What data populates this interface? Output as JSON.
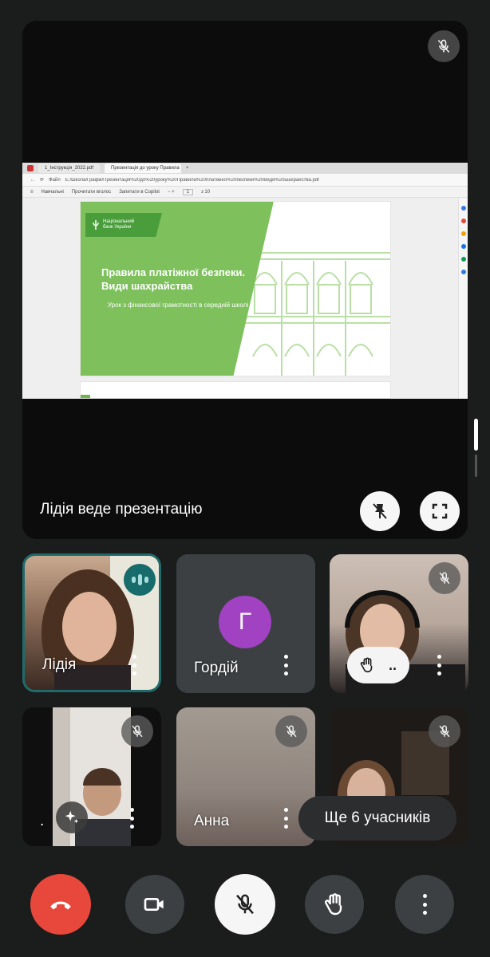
{
  "stage": {
    "presenter_caption": "Лідія веде презентацію",
    "browser": {
      "tab1": "1_Інструкція_2022.pdf",
      "tab2": "Презентація до уроку Правила",
      "address_label": "Файл",
      "address": "E:/Школа/Графік/Презентація%20до%20уроку%20Правила%20платіжної%20безпеки%20Види%20шахрайства.pdf",
      "toolbar_read": "Навчальні",
      "toolbar_ask": "Прочитати вголос",
      "toolbar_copilot": "Запитати в Copilot",
      "page_current": "1",
      "page_total": "з 10"
    },
    "slide": {
      "logo_text": "Національний\nбанк України",
      "title": "Правила платіжної безпеки. Види шахрайства",
      "subtitle": "Урок з фінансової грамотності в середній школі"
    }
  },
  "participants": [
    {
      "name": "Лідія",
      "state": "speaking"
    },
    {
      "name": "Гордій",
      "avatar_letter": "Г",
      "avatar_color": "#a142c2"
    },
    {
      "name": "",
      "hand_raised": true,
      "hand_label": ".."
    },
    {
      "name": "."
    },
    {
      "name": "Анна"
    },
    {
      "name": ""
    }
  ],
  "more_participants": "Ще 6 учасників",
  "controls": {
    "end_call_color": "#e8473b",
    "items": [
      "end-call-icon",
      "camera-icon",
      "mic-off-icon",
      "raise-hand-icon",
      "more-vert-icon"
    ]
  }
}
